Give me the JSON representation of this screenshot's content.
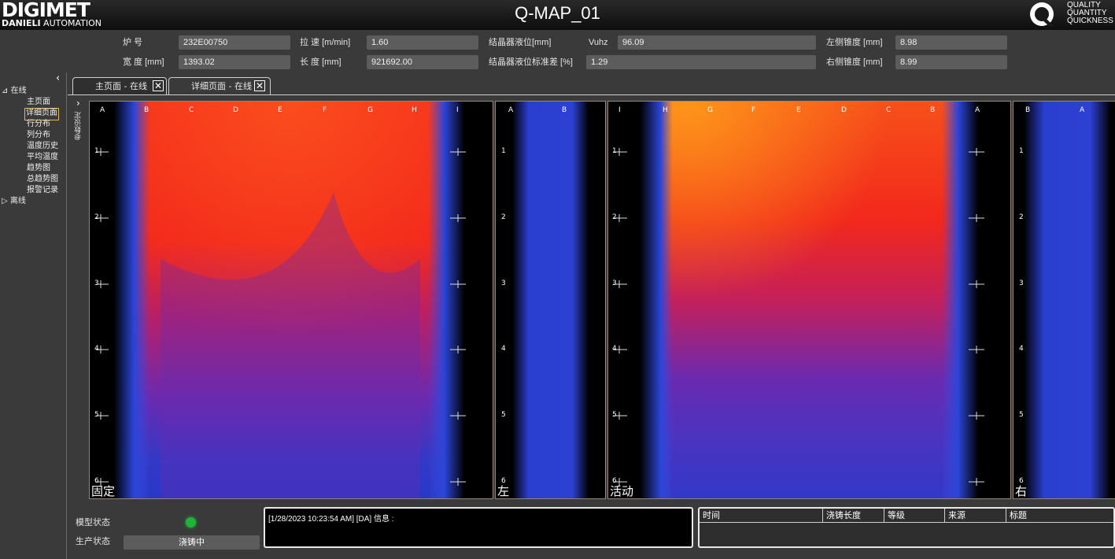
{
  "window": {
    "title": "Q-MAP_01",
    "logo": {
      "main": "DIGIMET",
      "sub_bold": "DANIELI",
      "sub_rest": " AUTOMATION"
    },
    "q_logo_lines": [
      "QUALITY",
      "QUANTITY",
      "QUICKNESS"
    ]
  },
  "info": {
    "furnace_no": {
      "label": "炉 号",
      "value": "232E00750"
    },
    "width": {
      "label": "宽 度 [mm]",
      "value": "1393.02"
    },
    "cast_speed": {
      "label": "拉 速 [m/min]",
      "value": "1.60"
    },
    "length": {
      "label": "长 度 [mm]",
      "value": "921692.00"
    },
    "mold_level": {
      "label": "结晶器液位[mm]",
      "value": ""
    },
    "vuhz": {
      "label": "Vuhz",
      "value": "96.09"
    },
    "mold_level_std": {
      "label": "结晶器液位标准差 [%]",
      "value": "1.29"
    },
    "left_taper": {
      "label": "左侧锥度 [mm]",
      "value": "8.98"
    },
    "right_taper": {
      "label": "右侧锥度 [mm]",
      "value": "8.99"
    }
  },
  "nav": {
    "collapse_icon": "chevron-left-icon",
    "online": {
      "label": "在线",
      "expanded": true
    },
    "items": [
      "主页面",
      "详细页面",
      "行分布",
      "列分布",
      "温度历史",
      "平均温度",
      "趋势图",
      "总趋势图",
      "报警记录"
    ],
    "selected_item": "详细页面",
    "offline": {
      "label": "离线",
      "expanded": false
    }
  },
  "side_toggle": {
    "label": "参数设定"
  },
  "tabs": [
    {
      "label": "主页面 - 在线",
      "active": false
    },
    {
      "label": "详细页面 - 在线",
      "active": true
    }
  ],
  "panels": {
    "fixed": {
      "title": "固定",
      "columns": [
        "A",
        "B",
        "C",
        "D",
        "E",
        "F",
        "G",
        "H",
        "I"
      ],
      "rows": [
        "1",
        "2",
        "3",
        "4",
        "5",
        "6"
      ]
    },
    "left": {
      "title": "左",
      "columns": [
        "A",
        "B"
      ],
      "rows": [
        "1",
        "2",
        "3",
        "4",
        "5",
        "6"
      ]
    },
    "moving": {
      "title": "活动",
      "columns": [
        "I",
        "H",
        "G",
        "F",
        "E",
        "D",
        "C",
        "B",
        "A"
      ],
      "rows": [
        "1",
        "2",
        "3",
        "4",
        "5",
        "6"
      ]
    },
    "right": {
      "title": "右",
      "columns": [
        "B",
        "A"
      ],
      "rows": [
        "1",
        "2",
        "3",
        "4",
        "5",
        "6"
      ]
    }
  },
  "status": {
    "model_label": "模型状态",
    "model_color": "#1fb33a",
    "production_label": "生产状态",
    "production_value": "浇铸中"
  },
  "messages": {
    "line": "[1/28/2023 10:23:54 AM] [DA]  信息 :"
  },
  "alarm_table": {
    "columns": [
      "时间",
      "浇铸长度",
      "等级",
      "来源",
      "标题"
    ]
  }
}
